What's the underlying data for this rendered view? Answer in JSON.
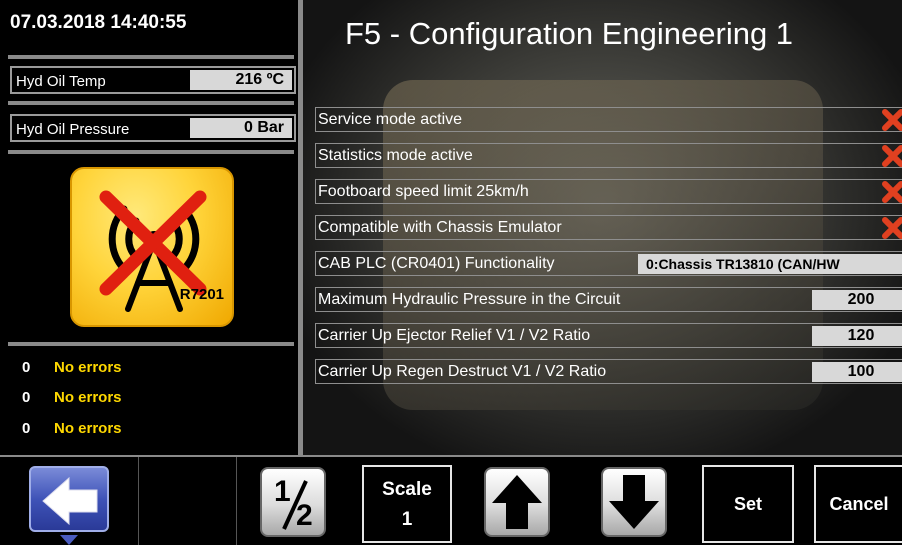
{
  "datetime": "07.03.2018 14:40:55",
  "left_panel": {
    "readouts": [
      {
        "label": "Hyd Oil Temp",
        "value": "216 ºC"
      },
      {
        "label": "Hyd Oil Pressure",
        "value": "0 Bar"
      }
    ],
    "radio_status": {
      "icon": "radio-no-signal-icon",
      "code": "R7201"
    },
    "errors": [
      {
        "count": "0",
        "message": "No errors"
      },
      {
        "count": "0",
        "message": "No errors"
      },
      {
        "count": "0",
        "message": "No errors"
      }
    ]
  },
  "main": {
    "title": "F5 - Configuration Engineering 1",
    "rows": [
      {
        "label": "Service mode active",
        "type": "flag",
        "icon": "red-x-icon"
      },
      {
        "label": "Statistics mode active",
        "type": "flag",
        "icon": "red-x-icon"
      },
      {
        "label": "Footboard speed limit 25km/h",
        "type": "flag",
        "icon": "red-x-icon"
      },
      {
        "label": "Compatible with Chassis Emulator",
        "type": "flag",
        "icon": "red-x-icon"
      },
      {
        "label": "CAB PLC (CR0401) Functionality",
        "type": "select",
        "value": "0:Chassis TR13810 (CAN/HW"
      },
      {
        "label": "Maximum Hydraulic Pressure in the Circuit",
        "type": "number",
        "value": "200"
      },
      {
        "label": "Carrier Up Ejector Relief V1 / V2 Ratio",
        "type": "number",
        "value": "120"
      },
      {
        "label": "Carrier Up Regen Destruct V1 / V2 Ratio",
        "type": "number",
        "value": "100"
      }
    ]
  },
  "toolbar": {
    "back_icon": "back-arrow-icon",
    "half_label_top": "1",
    "half_label_bottom": "2",
    "scale_label": "Scale",
    "scale_value": "1",
    "up_icon": "arrow-up-icon",
    "down_icon": "arrow-down-icon",
    "set_label": "Set",
    "cancel_label": "Cancel"
  },
  "colors": {
    "error_yellow": "#ffd800",
    "x_red": "#e04020",
    "back_blue": "#3f53b8"
  }
}
